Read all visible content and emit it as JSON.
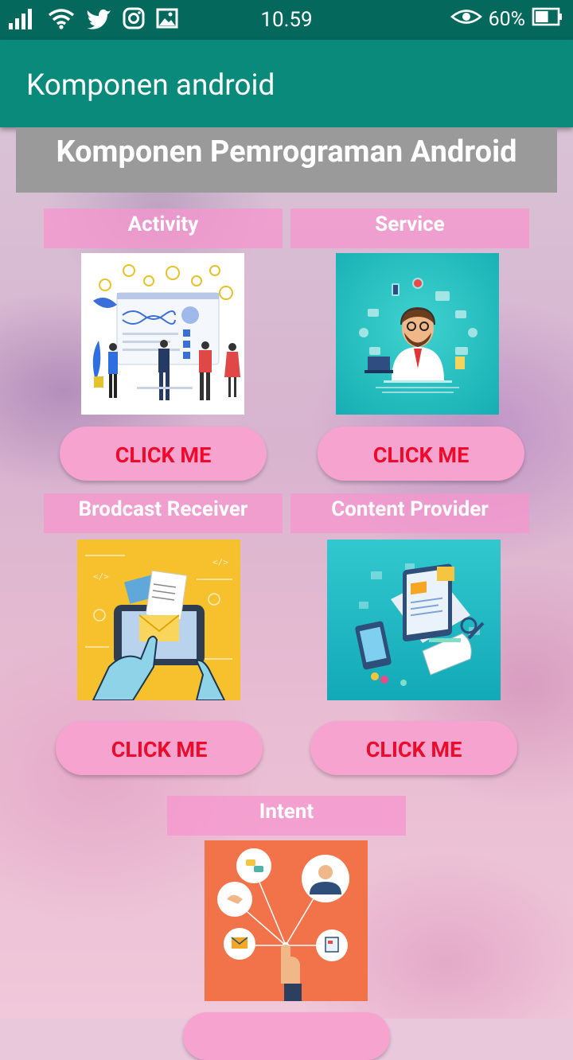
{
  "status_bar": {
    "time": "10.59",
    "battery_percent": "60%",
    "icons": [
      "signal-icon",
      "wifi-icon",
      "twitter-icon",
      "instagram-icon",
      "gallery-icon",
      "eye-icon",
      "battery-icon"
    ],
    "battery_level": 0.6
  },
  "app_bar": {
    "title": "Komponen android"
  },
  "main_title": "Komponen Pemrograman Android",
  "cards": {
    "activity": {
      "label": "Activity",
      "button": "CLICK ME"
    },
    "service": {
      "label": "Service",
      "button": "CLICK ME"
    },
    "broadcast": {
      "label": "Brodcast Receiver",
      "button": "CLICK ME"
    },
    "content": {
      "label": "Content Provider",
      "button": "CLICK ME"
    },
    "intent": {
      "label": "Intent"
    }
  },
  "colors": {
    "status_bar": "#04685d",
    "app_bar": "#0a8a7a",
    "title_bg": "#9a9a9a",
    "label_bg": "#f596cd",
    "button_bg": "#f7a3cf",
    "button_text": "#ee0a2a"
  }
}
